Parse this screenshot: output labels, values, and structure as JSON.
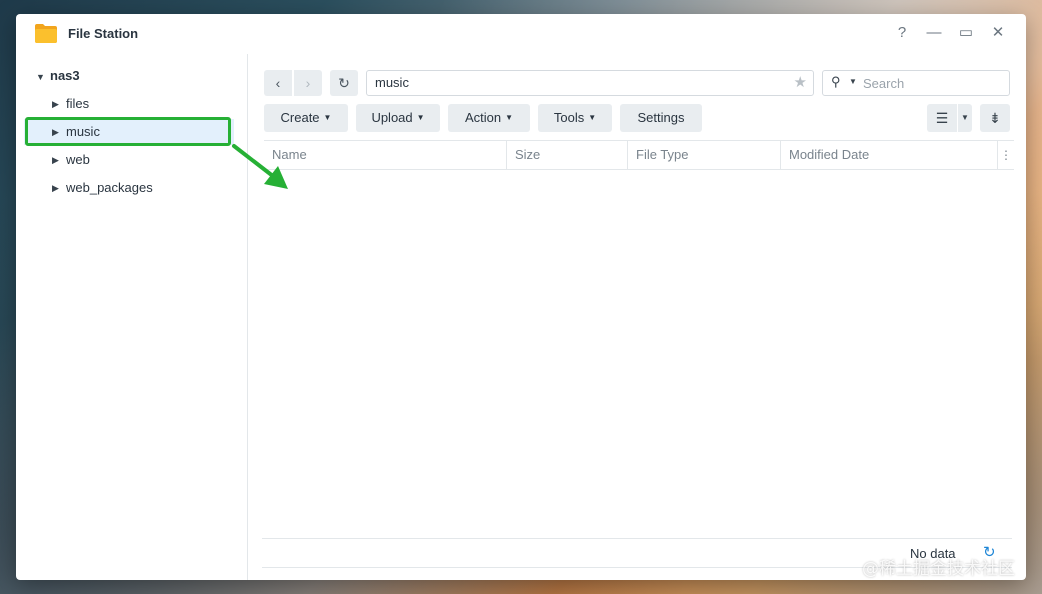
{
  "window": {
    "title": "File Station",
    "controls": {
      "help": "?",
      "minimize": "—",
      "maximize": "▭",
      "close": "✕"
    }
  },
  "sidebar": {
    "root": "nas3",
    "items": [
      {
        "label": "files"
      },
      {
        "label": "music",
        "selected": true
      },
      {
        "label": "web"
      },
      {
        "label": "web_packages"
      }
    ]
  },
  "toolbar": {
    "path": "music",
    "search_placeholder": "Search",
    "buttons": [
      "Create",
      "Upload",
      "Action",
      "Tools",
      "Settings"
    ]
  },
  "grid": {
    "columns": [
      "Name",
      "Size",
      "File Type",
      "Modified Date"
    ]
  },
  "status": {
    "text": "No data"
  },
  "watermark": "@稀土掘金技术社区",
  "colors": {
    "highlight": "#26b035",
    "selected_bg": "#e3f0fc",
    "accent": "#1f86d6"
  }
}
